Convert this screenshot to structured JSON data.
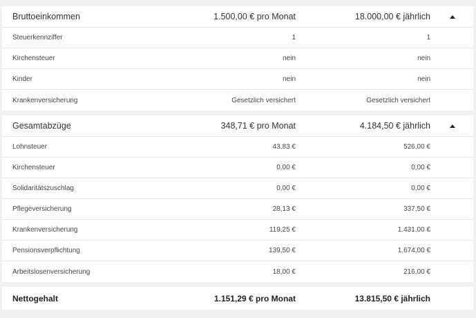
{
  "gross": {
    "label": "Bruttoeinkommen",
    "month": "1.500,00 € pro Monat",
    "year": "18.000,00 € jährlich",
    "rows": [
      {
        "label": "Steuerkennziffer",
        "month": "1",
        "year": "1"
      },
      {
        "label": "Kirchensteuer",
        "month": "nein",
        "year": "nein"
      },
      {
        "label": "Kinder",
        "month": "nein",
        "year": "nein"
      },
      {
        "label": "Krankenversicherung",
        "month": "Gesetzlich versichert",
        "year": "Gesetzlich versichert"
      }
    ]
  },
  "deductions": {
    "label": "Gesamtabzüge",
    "month": "348,71 € pro Monat",
    "year": "4.184,50 € jährlich",
    "rows": [
      {
        "label": "Lohnsteuer",
        "month": "43,83 €",
        "year": "526,00 €"
      },
      {
        "label": "Kirchensteuer",
        "month": "0,00 €",
        "year": "0,00 €"
      },
      {
        "label": "Solidaritätszuschlag",
        "month": "0,00 €",
        "year": "0,00 €"
      },
      {
        "label": "Pflegeversicherung",
        "month": "28,13 €",
        "year": "337,50 €"
      },
      {
        "label": "Krankenversicherung",
        "month": "119,25 €",
        "year": "1.431,00 €"
      },
      {
        "label": "Pensionsverpflichtung",
        "month": "139,50 €",
        "year": "1.674,00 €"
      },
      {
        "label": "Arbeitslosenversicherung",
        "month": "18,00 €",
        "year": "216,00 €"
      }
    ]
  },
  "net": {
    "label": "Nettogehalt",
    "month": "1.151,29 € pro Monat",
    "year": "13.815,50 € jährlich"
  }
}
